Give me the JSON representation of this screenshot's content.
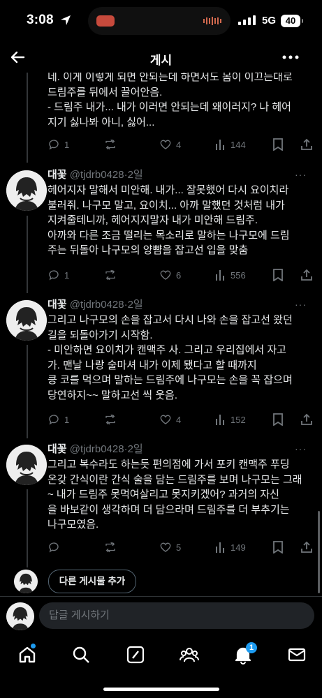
{
  "status_bar": {
    "time": "3:08",
    "network": "5G",
    "battery": "40"
  },
  "header": {
    "title": "게시"
  },
  "top_post_tail": {
    "text": "네. 이게 이렇게 되면 안되는데 하면서도 몸이 이끄는대로\n드림주를 뒤에서 끌어안음.\n- 드림주 내가... 내가 이러면 안되는데 왜이러지? 나 헤어\n지기 싫나봐 아니, 싫어...",
    "replies": "1",
    "reposts": "",
    "likes": "4",
    "views": "144"
  },
  "posts": [
    {
      "name": "대꽃",
      "handle": "@tjdrb0428",
      "sep": "·",
      "time": "2일",
      "text": "헤어지자 말해서 미안해. 내가... 잘못했어 다시 요이치라\n불러줘. 나구모 말고, 요이치... 아까 말했던 것처럼 내가\n지켜줄테니까, 헤어지지말자 내가 미안해 드림주.\n아까와 다른 조금 떨리는 목소리로 말하는 나구모에 드림\n주는 뒤돌아 나구모의 양뺨을 잡고선 입을 맞춤",
      "replies": "1",
      "reposts": "",
      "likes": "6",
      "views": "556"
    },
    {
      "name": "대꽃",
      "handle": "@tjdrb0428",
      "sep": "·",
      "time": "2일",
      "text": "그리고 나구모의 손을 잡고서 다시 나와 손을 잡고선 왔던\n길을 되돌아가기 시작함.\n- 미안하면 요이치가 캔맥주 사. 그리고 우리집에서 자고\n가. 맨날 나랑 술마셔 내가 이제 됐다고 할 때까지\n킁 코를 먹으며 말하는 드림주에 나구모는 손을 꼭 잡으며\n당연하지~~ 말하고선 씩 웃음.",
      "replies": "1",
      "reposts": "",
      "likes": "4",
      "views": "152"
    },
    {
      "name": "대꽃",
      "handle": "@tjdrb0428",
      "sep": "·",
      "time": "2일",
      "text": "그리고 복수라도 하는듯 편의점에 가서 포키 캔맥주 푸딩\n온갖 간식이란 간식 술을 담는 드림주를 보며 나구모는 그래\n~ 내가 드림주 못먹여살리고 못지키겠어? 과거의 자신\n을 바보같이 생각하며 더 담으라며 드림주를 더 부추기는\n나구모였음.",
      "replies": "",
      "reposts": "",
      "likes": "5",
      "views": "149"
    }
  ],
  "add_post_label": "다른 게시물 추가",
  "reply_placeholder": "답글 게시하기",
  "notifications_badge": "1",
  "colors": {
    "accent": "#1d9bf0",
    "background": "#000000",
    "muted": "#71767b"
  },
  "icons": [
    "back-arrow-icon",
    "more-icon",
    "reply-icon",
    "repost-icon",
    "like-icon",
    "views-icon",
    "bookmark-icon",
    "share-icon",
    "home-icon",
    "search-icon",
    "compose-icon",
    "communities-icon",
    "notifications-icon",
    "messages-icon"
  ]
}
